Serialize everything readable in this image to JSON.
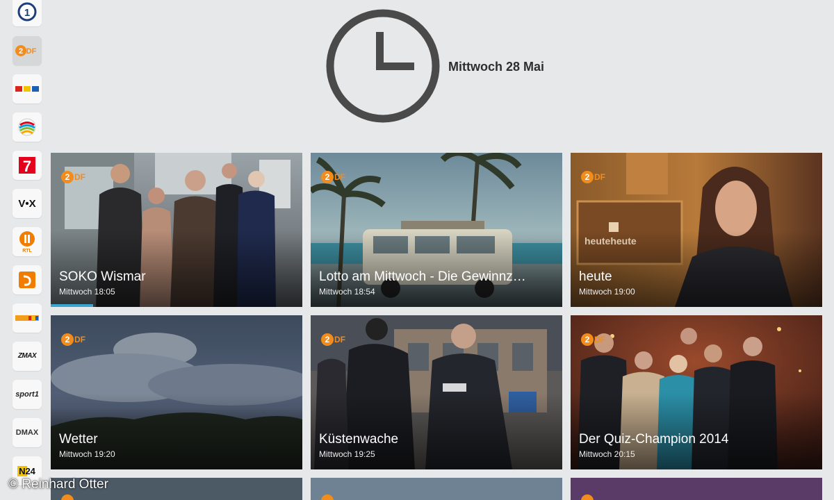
{
  "header": {
    "date": "Mittwoch 28 Mai"
  },
  "colors": {
    "background": "#e7e8ea",
    "clock": "#4a4a4a",
    "zdf_orange": "#f28c1c",
    "progress": "#3aa6cf"
  },
  "channels": [
    {
      "name": "Das Erste",
      "icon": "das-erste-logo-icon",
      "label": "1"
    },
    {
      "name": "ZDF",
      "icon": "zdf-logo-icon",
      "label": "2DF",
      "active": true
    },
    {
      "name": "RTL",
      "icon": "rtl-logo-icon",
      "label": "RTL"
    },
    {
      "name": "Sat.1",
      "icon": "sat1-logo-icon",
      "label": ""
    },
    {
      "name": "ProSieben",
      "icon": "prosieben-logo-icon",
      "label": "7"
    },
    {
      "name": "VOX",
      "icon": "vox-logo-icon",
      "label": "V•X"
    },
    {
      "name": "RTL II",
      "icon": "rtl2-logo-icon",
      "label": "RTL"
    },
    {
      "name": "Kabel eins",
      "icon": "kabel-eins-logo-icon",
      "label": ""
    },
    {
      "name": "Super RTL",
      "icon": "super-rtl-logo-icon",
      "label": ""
    },
    {
      "name": "ZDFneo / ZMAX",
      "icon": "zmax-logo-icon",
      "label": "ZMAX"
    },
    {
      "name": "Sport1",
      "icon": "sport1-logo-icon",
      "label": "sport1"
    },
    {
      "name": "DMAX",
      "icon": "dmax-logo-icon",
      "label": "DMAX"
    },
    {
      "name": "N24",
      "icon": "n24-logo-icon",
      "label": "N24"
    }
  ],
  "programs": [
    {
      "title": "SOKO Wismar",
      "time": "Mittwoch 18:05",
      "progress": 0.17,
      "logo": "zdf-logo-icon"
    },
    {
      "title": "Lotto am Mittwoch - Die Gewinnz…",
      "time": "Mittwoch 18:54",
      "logo": "zdf-logo-icon"
    },
    {
      "title": "heute",
      "time": "Mittwoch 19:00",
      "logo": "zdf-logo-icon"
    },
    {
      "title": "Wetter",
      "time": "Mittwoch 19:20",
      "logo": "zdf-logo-icon"
    },
    {
      "title": "Küstenwache",
      "time": "Mittwoch 19:25",
      "logo": "zdf-logo-icon"
    },
    {
      "title": "Der Quiz-Champion 2014",
      "time": "Mittwoch 20:15",
      "logo": "zdf-logo-icon"
    }
  ],
  "credit": "© Reinhard Otter"
}
